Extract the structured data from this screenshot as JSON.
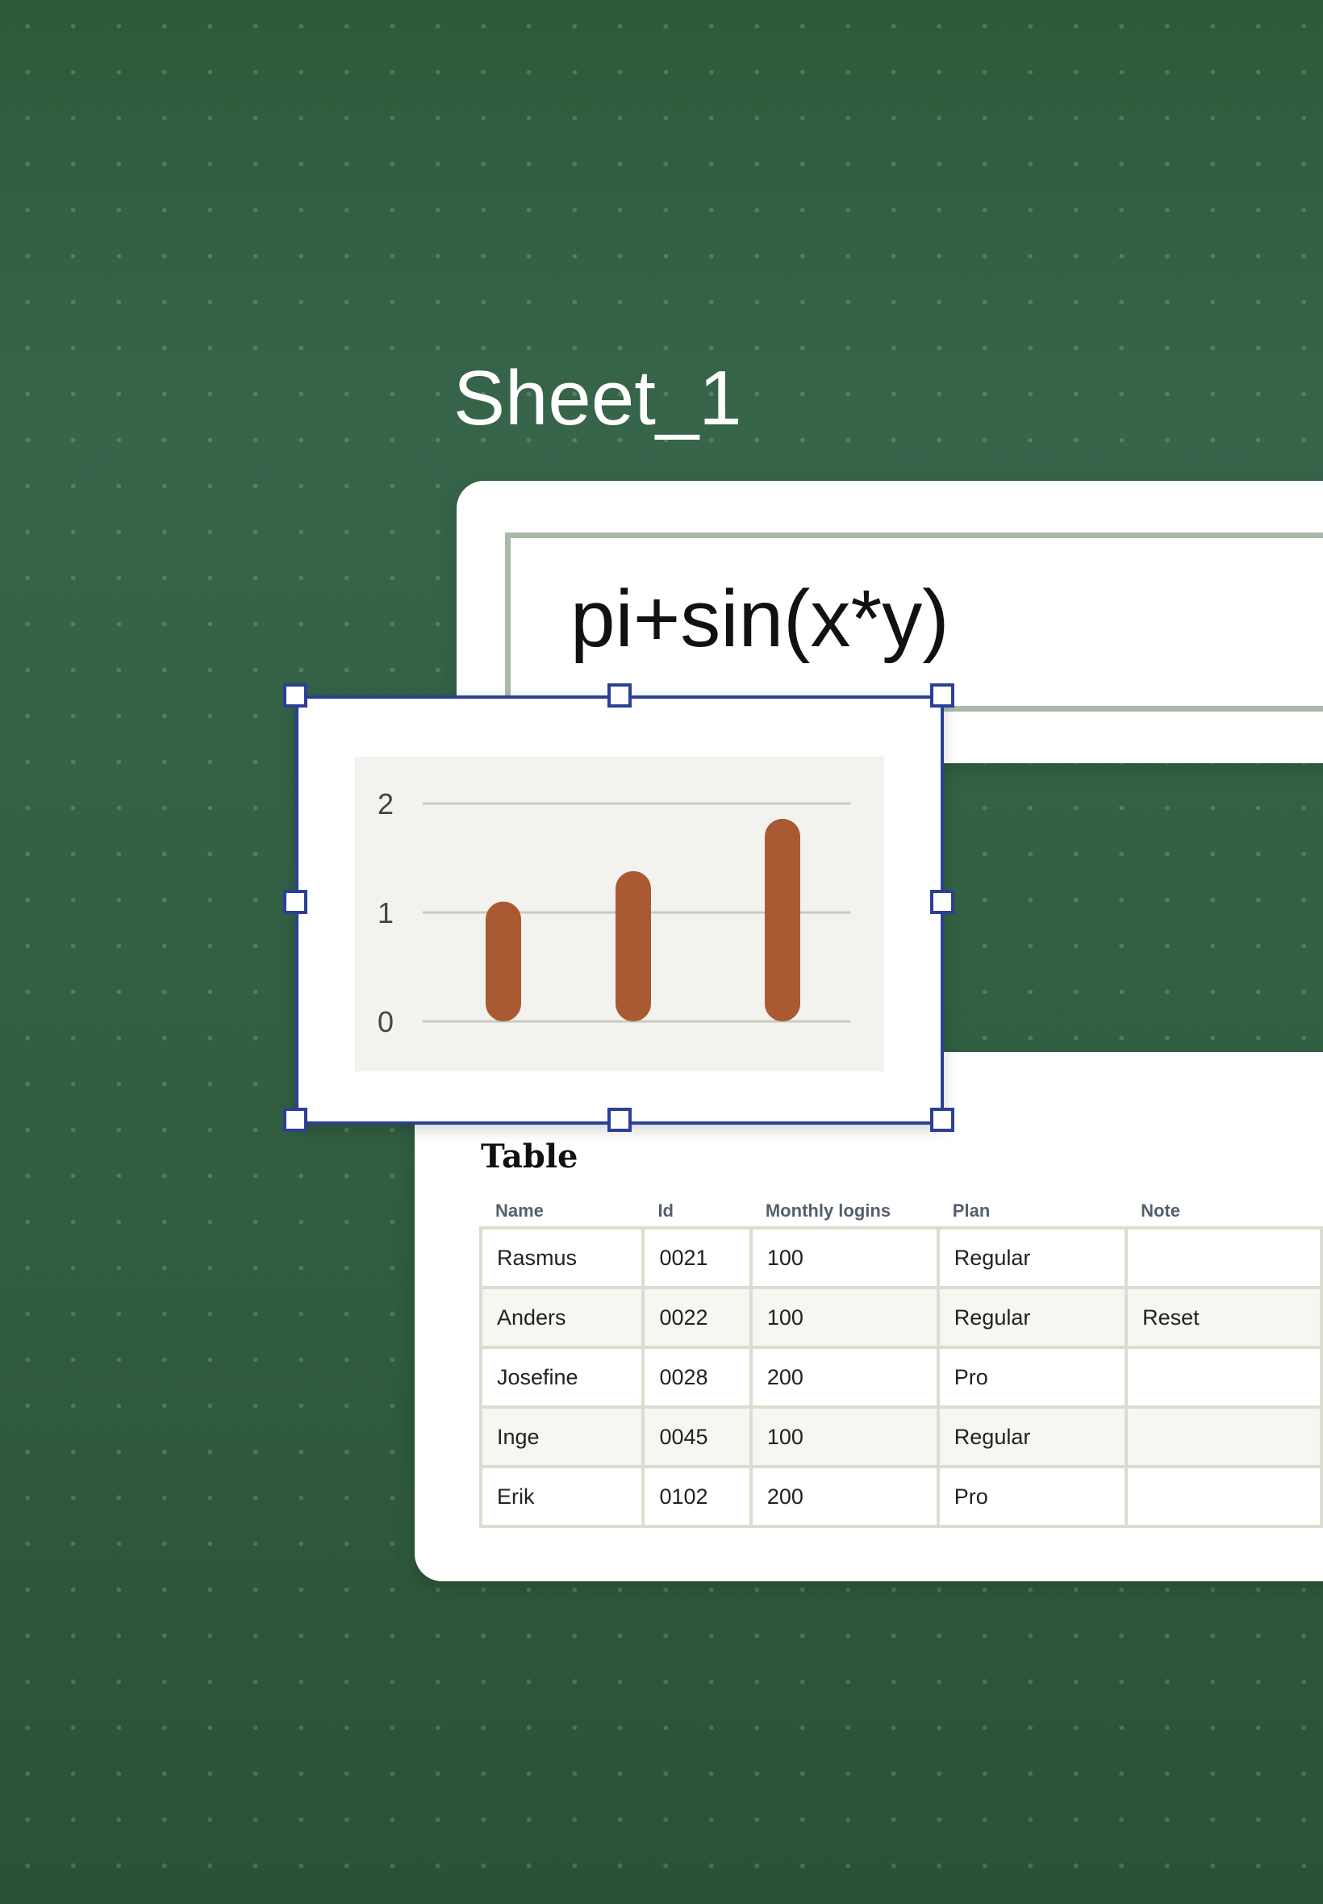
{
  "sheet": {
    "title": "Sheet_1"
  },
  "formula": {
    "value": "pi+sin(x*y)"
  },
  "table": {
    "title": "Table",
    "columns": [
      "Name",
      "Id",
      "Monthly logins",
      "Plan",
      "Note"
    ],
    "rows": [
      [
        "Rasmus",
        "0021",
        "100",
        "Regular",
        ""
      ],
      [
        "Anders",
        "0022",
        "100",
        "Regular",
        "Reset"
      ],
      [
        "Josefine",
        "0028",
        "200",
        "Pro",
        ""
      ],
      [
        "Inge",
        "0045",
        "100",
        "Regular",
        ""
      ],
      [
        "Erik",
        "0102",
        "200",
        "Pro",
        ""
      ]
    ]
  },
  "colors": {
    "background": "#33603f",
    "selection": "#2c3f96",
    "bar": "#a95a32",
    "plot_background": "#f2f2ee"
  },
  "chart_data": {
    "type": "bar",
    "categories": [
      "",
      "",
      ""
    ],
    "values": [
      1.1,
      1.38,
      1.86
    ],
    "title": "",
    "xlabel": "",
    "ylabel": "",
    "ylim": [
      0,
      2
    ],
    "yticks": [
      "0",
      "1",
      "2"
    ],
    "grid": true,
    "legend": "none"
  }
}
